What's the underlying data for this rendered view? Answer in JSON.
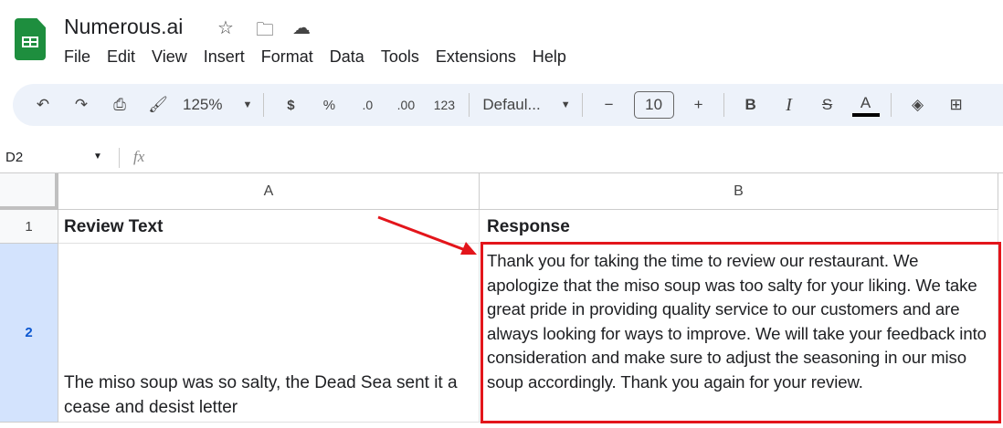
{
  "app": {
    "title": "Numerous.ai"
  },
  "menu": [
    "File",
    "Edit",
    "View",
    "Insert",
    "Format",
    "Data",
    "Tools",
    "Extensions",
    "Help"
  ],
  "toolbar": {
    "zoom": "125%",
    "currency": "$",
    "percent": "%",
    "dec_decrease": ".0",
    "dec_increase": ".00",
    "number_format": "123",
    "font": "Defaul...",
    "font_size": "10"
  },
  "formula_bar": {
    "cell_ref": "D2",
    "fx": "fx",
    "value": ""
  },
  "columns": [
    "A",
    "B"
  ],
  "rows": [
    {
      "num": "1",
      "a": "Review Text",
      "b": "Response"
    },
    {
      "num": "2",
      "a": "The miso soup was so salty, the Dead Sea sent it a cease and desist letter",
      "b": "Thank you for taking the time to review our restaurant. We apologize that the miso soup was too salty for your liking. We take great pride in providing quality service to our customers and are always looking for ways to improve. We will take your feedback into consideration and make sure to adjust the seasoning in our miso soup accordingly. Thank you again for your review."
    }
  ],
  "colors": {
    "highlight": "#e3151b",
    "selected_row_header": "#d3e3fd"
  }
}
